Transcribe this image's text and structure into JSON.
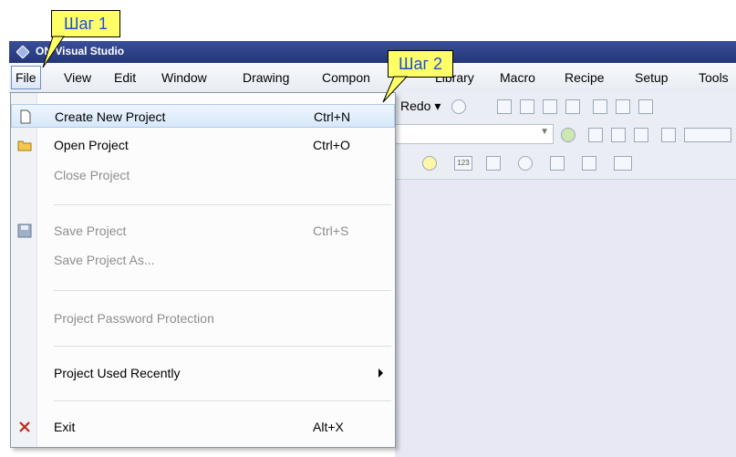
{
  "window": {
    "title": "ON Visual Studio"
  },
  "menubar": {
    "items": [
      "File",
      "View",
      "Edit",
      "Window",
      "Drawing",
      "Compon",
      "Library",
      "Macro",
      "Recipe",
      "Setup",
      "Tools"
    ]
  },
  "toolbar": {
    "redo_label": "Redo",
    "row3_counter": "123"
  },
  "annotations": {
    "step1": "Шаг 1",
    "step2": "Шаг 2"
  },
  "file_menu": {
    "create_new": {
      "label": "Create New Project",
      "shortcut": "Ctrl+N"
    },
    "open": {
      "label": "Open Project",
      "shortcut": "Ctrl+O"
    },
    "close": {
      "label": "Close Project"
    },
    "save": {
      "label": "Save Project",
      "shortcut": "Ctrl+S"
    },
    "save_as": {
      "label": "Save Project As..."
    },
    "password": {
      "label": "Project Password Protection"
    },
    "recent": {
      "label": "Project Used Recently"
    },
    "exit": {
      "label": "Exit",
      "shortcut": "Alt+X"
    }
  },
  "colors": {
    "titlebar": "#2c3f86",
    "callout_bg": "#ffff66",
    "callout_text": "#1a4fd6",
    "canvas": "#e8e8f4"
  }
}
